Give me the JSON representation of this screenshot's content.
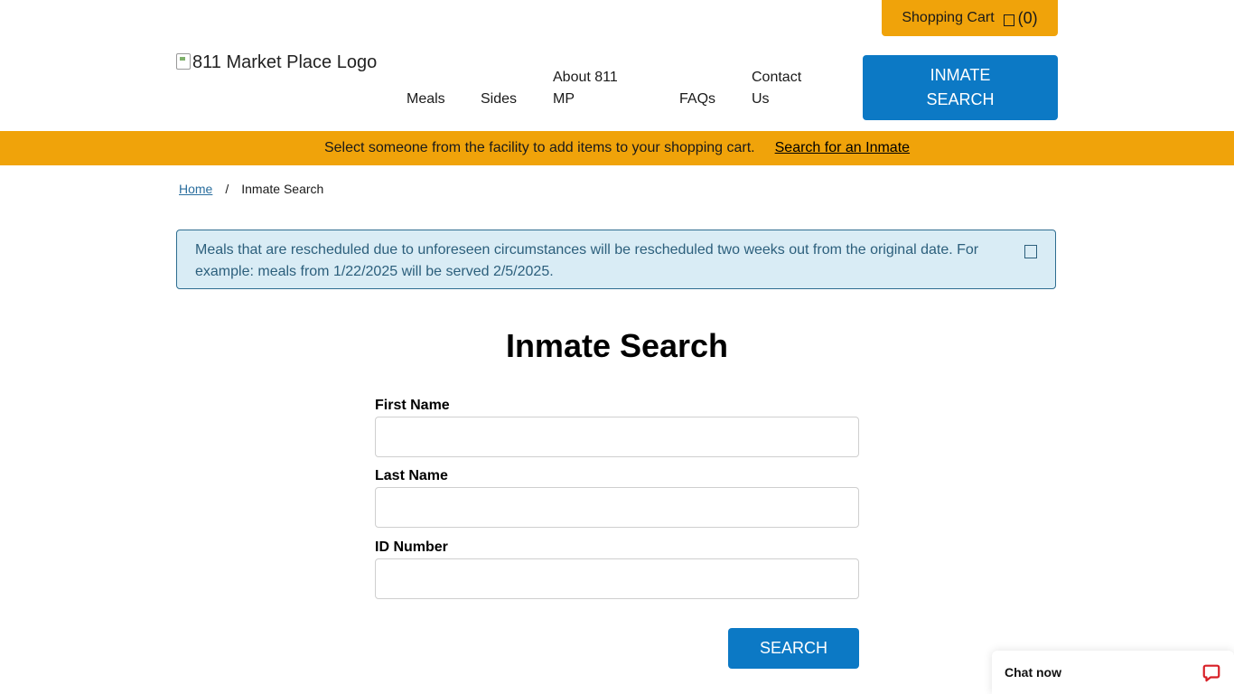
{
  "header": {
    "cart_label": "Shopping Cart",
    "cart_count": "(0)",
    "logo_alt": "811 Market Place Logo",
    "nav": {
      "meals": "Meals",
      "sides": "Sides",
      "about": "About 811 MP",
      "faqs": "FAQs",
      "contact": "Contact Us"
    },
    "inmate_search_button": "INMATE SEARCH"
  },
  "banner": {
    "text": "Select someone from the facility to add items to your shopping cart.",
    "link": "Search for an Inmate"
  },
  "breadcrumb": {
    "home": "Home",
    "separator": "/",
    "current": "Inmate Search"
  },
  "alert": {
    "text": "Meals that are rescheduled due to unforeseen circumstances will be rescheduled two weeks out from the original date. For example: meals from 1/22/2025 will be served 2/5/2025."
  },
  "form": {
    "title": "Inmate Search",
    "first_name_label": "First Name",
    "first_name_value": "",
    "last_name_label": "Last Name",
    "last_name_value": "",
    "id_label": "ID Number",
    "id_value": "",
    "submit": "SEARCH"
  },
  "chat": {
    "label": "Chat now",
    "icon": "chat-bubble-icon"
  },
  "colors": {
    "accent_orange": "#f0a30a",
    "primary_blue": "#0c79c5",
    "alert_bg": "#d9ecf5",
    "chat_red": "#d81f26"
  }
}
